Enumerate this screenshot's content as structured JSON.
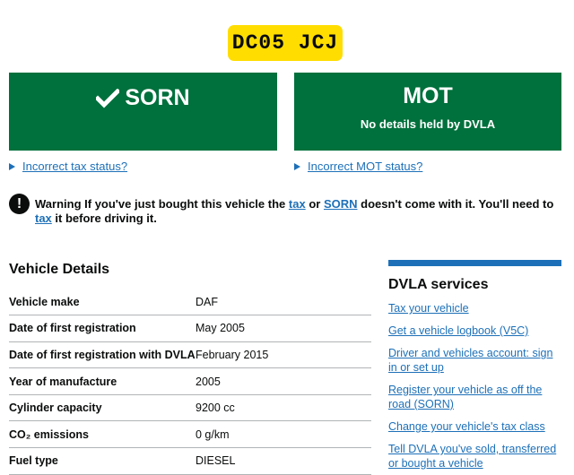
{
  "plate": "DC05 JCJ",
  "tax_status": {
    "title": "SORN",
    "link": "Incorrect tax status?"
  },
  "mot_status": {
    "title": "MOT",
    "subtitle": "No details held by DVLA",
    "link": "Incorrect MOT status?"
  },
  "warning": {
    "icon": "!",
    "label": "Warning",
    "text_1": "If you've just bought this vehicle the",
    "link_tax": "tax",
    "text_2": "or",
    "link_sorn": "SORN",
    "text_3": "doesn't come with it. You'll need to",
    "link_tax_2": "tax",
    "text_4": "it before driving it."
  },
  "vehicle_details": {
    "heading": "Vehicle Details",
    "rows": [
      {
        "key": "Vehicle make",
        "value": "DAF"
      },
      {
        "key": "Date of first registration",
        "value": "May 2005"
      },
      {
        "key": "Date of first registration with DVLA",
        "value": "February 2015"
      },
      {
        "key": "Year of manufacture",
        "value": "2005"
      },
      {
        "key": "Cylinder capacity",
        "value": "9200 cc"
      },
      {
        "key": "CO₂ emissions",
        "value": "0 g/km"
      },
      {
        "key": "Fuel type",
        "value": "DIESEL"
      }
    ]
  },
  "dvla_services": {
    "heading": "DVLA services",
    "links": [
      "Tax your vehicle",
      "Get a vehicle logbook (V5C)",
      "Driver and vehicles account: sign in or set up",
      "Register your vehicle as off the road (SORN)",
      "Change your vehicle's tax class",
      "Tell DVLA you've sold, transferred or bought a vehicle"
    ]
  },
  "colors": {
    "plate": "#ffdd00",
    "status_green": "#00703c",
    "link_blue": "#1d70b8",
    "text": "#0b0c0c"
  }
}
